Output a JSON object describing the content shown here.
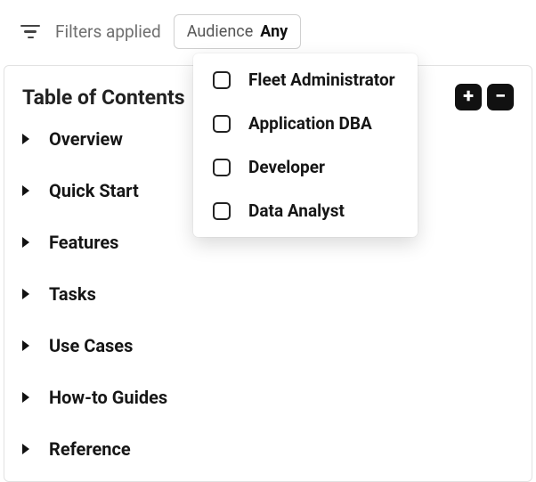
{
  "filterBar": {
    "filtersAppliedLabel": "Filters applied",
    "audienceLabel": "Audience",
    "audienceValue": "Any"
  },
  "dropdown": {
    "items": [
      {
        "label": "Fleet Administrator"
      },
      {
        "label": "Application DBA"
      },
      {
        "label": "Developer"
      },
      {
        "label": "Data Analyst"
      }
    ]
  },
  "toc": {
    "title": "Table of Contents",
    "expandSymbol": "+",
    "collapseSymbol": "−",
    "items": [
      {
        "label": "Overview"
      },
      {
        "label": "Quick Start"
      },
      {
        "label": "Features"
      },
      {
        "label": "Tasks"
      },
      {
        "label": "Use Cases"
      },
      {
        "label": "How-to Guides"
      },
      {
        "label": "Reference"
      }
    ]
  }
}
